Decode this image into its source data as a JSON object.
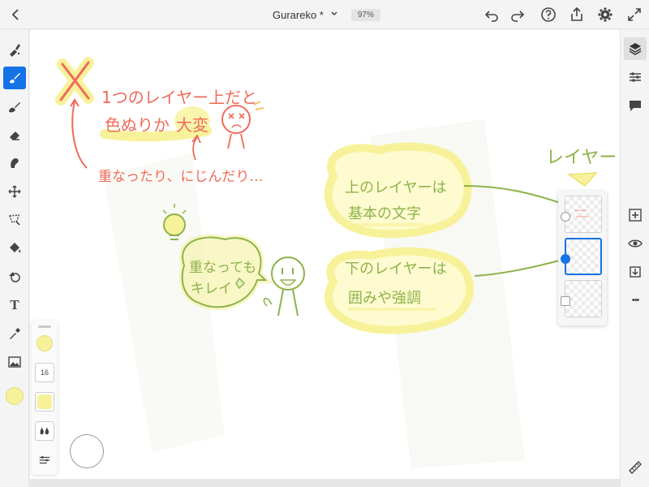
{
  "header": {
    "doc_title": "Gurareko *",
    "zoom": "97%",
    "back_icon": "chevron-left-icon",
    "right_icons": [
      "undo-icon",
      "redo-icon",
      "help-icon",
      "share-icon",
      "settings-icon",
      "fullscreen-icon"
    ]
  },
  "toolbar": {
    "tools": [
      "pixel-brush",
      "live-brush",
      "vector-brush",
      "eraser",
      "smudge",
      "move",
      "select",
      "fill",
      "shape",
      "text",
      "eyedropper",
      "image",
      "color"
    ],
    "active_tool": "live-brush",
    "text_tool_glyph": "T",
    "brush_color": "#f7f29a"
  },
  "brush_panel": {
    "size_label": "16",
    "swatch_color": "#f7f29a"
  },
  "right_panel": {
    "icons": [
      "layers-icon",
      "properties-icon",
      "comments-icon",
      "add-layer-icon",
      "visibility-icon",
      "merge-icon",
      "more-icon",
      "ruler-icon"
    ],
    "more_glyph": "•••"
  },
  "layers": {
    "count": 3,
    "selected_index": 1
  },
  "canvas_text": {
    "line1": "1つのレイヤー上だと",
    "line2_a": "色ぬりか",
    "line2_b": "大変",
    "line3": "重なったり、にじんだり…",
    "bubble1_l1": "重なっても",
    "bubble1_l2": "キレイ",
    "bubble2_l1": "上のレイヤーは",
    "bubble2_l2": "基本の文字",
    "bubble3_l1": "下のレイヤーは",
    "bubble3_l2": "囲みや強調",
    "layer_label": "レイヤー"
  },
  "colors": {
    "accent": "#1473e6",
    "ink_red": "#f06a5a",
    "ink_green": "#8db34a",
    "highlight_yellow": "#f7f29a"
  }
}
